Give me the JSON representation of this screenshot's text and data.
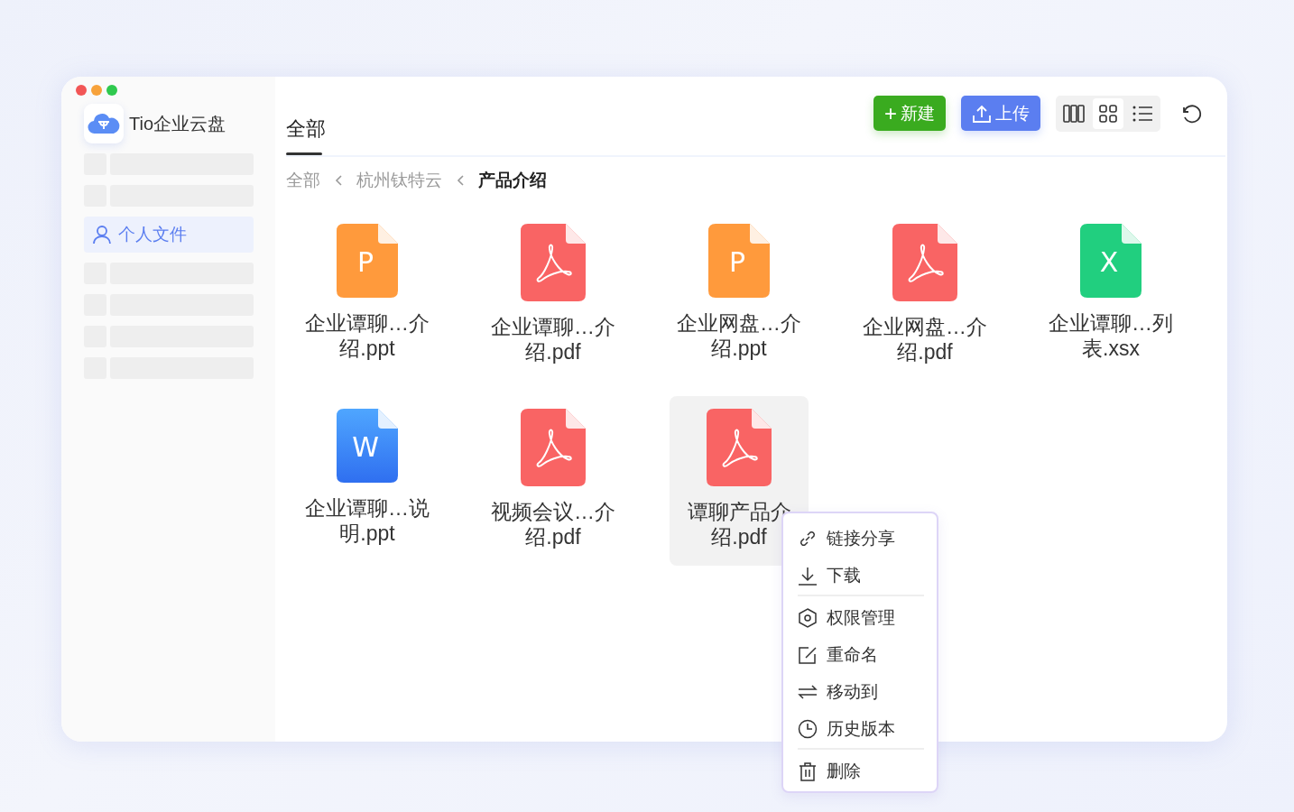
{
  "app": {
    "name": "Tio企业云盘"
  },
  "sidebar": {
    "items": [
      {
        "label": "个人文件",
        "selected": true
      }
    ]
  },
  "header": {
    "title": "全部",
    "buttons": [
      {
        "kind": "new",
        "label": "新建",
        "icon": "+"
      },
      {
        "kind": "upload",
        "label": "上传"
      }
    ],
    "view_modes": [
      {
        "kind": "columns",
        "selected": false
      },
      {
        "kind": "grid",
        "selected": true
      },
      {
        "kind": "list",
        "selected": false
      }
    ]
  },
  "breadcrumb": [
    {
      "label": "全部",
      "current": false
    },
    {
      "label": "杭州钛特云",
      "current": false
    },
    {
      "label": "产品介绍",
      "current": true
    }
  ],
  "files": [
    {
      "kind": "ppt",
      "letter": "P",
      "name": "企业谭聊…介绍.ppt",
      "selected": false
    },
    {
      "kind": "pdf",
      "name": "企业谭聊…介绍.pdf",
      "selected": false
    },
    {
      "kind": "ppt",
      "letter": "P",
      "name": "企业网盘…介绍.ppt",
      "selected": false
    },
    {
      "kind": "pdf",
      "name": "企业网盘…介绍.pdf",
      "selected": false
    },
    {
      "kind": "xlsx",
      "letter": "X",
      "name": "企业谭聊…列表.xsx",
      "selected": false
    },
    {
      "kind": "doc",
      "letter": "W",
      "name": "企业谭聊…说明.ppt",
      "selected": false
    },
    {
      "kind": "pdf",
      "name": "视频会议…介绍.pdf",
      "selected": false
    },
    {
      "kind": "pdf",
      "name": "谭聊产品介绍.pdf",
      "selected": true
    }
  ],
  "context_menu": {
    "items": [
      {
        "kind": "link",
        "label": "链接分享"
      },
      {
        "kind": "download",
        "label": "下载"
      },
      {
        "kind": "divider"
      },
      {
        "kind": "permission",
        "label": "权限管理"
      },
      {
        "kind": "rename",
        "label": "重命名"
      },
      {
        "kind": "move",
        "label": "移动到"
      },
      {
        "kind": "history",
        "label": "历史版本"
      },
      {
        "kind": "divider"
      },
      {
        "kind": "delete",
        "label": "删除"
      }
    ]
  }
}
